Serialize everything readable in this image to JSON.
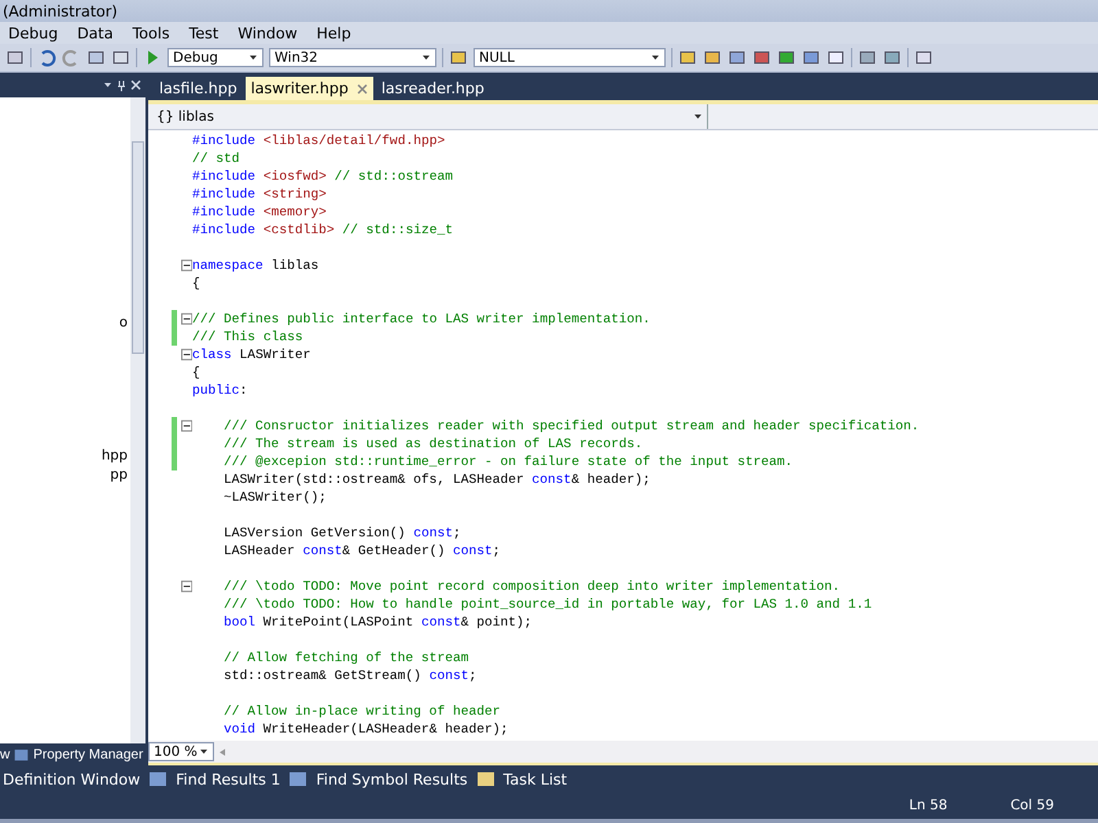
{
  "window": {
    "title": "(Administrator)"
  },
  "menu": [
    "Debug",
    "Data",
    "Tools",
    "Test",
    "Window",
    "Help"
  ],
  "toolbar": {
    "configuration": "Debug",
    "platform": "Win32",
    "target": "NULL"
  },
  "left_panel": {
    "items": [
      "o",
      "hpp",
      "pp"
    ],
    "bottom_tabs": [
      {
        "label": "w",
        "selected": false
      },
      {
        "label": "Property Manager",
        "selected": false
      }
    ]
  },
  "tabs": [
    {
      "label": "lasfile.hpp",
      "selected": false
    },
    {
      "label": "laswriter.hpp",
      "selected": true
    },
    {
      "label": "lasreader.hpp",
      "selected": false
    }
  ],
  "navigation": {
    "scope": "{} liblas"
  },
  "code": [
    {
      "kind": "code",
      "indented": false,
      "fold": false,
      "changed": false,
      "segments": [
        {
          "t": "#include",
          "kind": "keyword"
        },
        {
          "t": " <liblas/detail/fwd.hpp>",
          "kind": "string"
        }
      ]
    },
    {
      "kind": "code",
      "indented": false,
      "fold": false,
      "changed": false,
      "segments": [
        {
          "t": "// std",
          "kind": "comment"
        }
      ]
    },
    {
      "kind": "code",
      "indented": false,
      "fold": false,
      "changed": false,
      "segments": [
        {
          "t": "#include",
          "kind": "keyword"
        },
        {
          "t": " <iosfwd>",
          "kind": "string"
        },
        {
          "t": " // std::ostream",
          "kind": "comment"
        }
      ]
    },
    {
      "kind": "code",
      "indented": false,
      "fold": false,
      "changed": false,
      "segments": [
        {
          "t": "#include",
          "kind": "keyword"
        },
        {
          "t": " <string>",
          "kind": "string"
        }
      ]
    },
    {
      "kind": "code",
      "indented": false,
      "fold": false,
      "changed": false,
      "segments": [
        {
          "t": "#include",
          "kind": "keyword"
        },
        {
          "t": " <memory>",
          "kind": "string"
        }
      ]
    },
    {
      "kind": "code",
      "indented": false,
      "fold": false,
      "changed": false,
      "segments": [
        {
          "t": "#include",
          "kind": "keyword"
        },
        {
          "t": " <cstdlib>",
          "kind": "string"
        },
        {
          "t": " // std::size_t",
          "kind": "comment"
        }
      ]
    },
    {
      "kind": "blank"
    },
    {
      "kind": "code",
      "indented": false,
      "fold": true,
      "changed": false,
      "segments": [
        {
          "t": "namespace",
          "kind": "keyword"
        },
        {
          "t": " liblas"
        }
      ]
    },
    {
      "kind": "code",
      "indented": false,
      "fold": false,
      "changed": false,
      "segments": [
        {
          "t": "{"
        }
      ]
    },
    {
      "kind": "blank"
    },
    {
      "kind": "code",
      "indented": false,
      "fold": true,
      "changed": true,
      "segments": [
        {
          "t": "/// Defines public interface to LAS writer implementation.",
          "kind": "comment"
        }
      ]
    },
    {
      "kind": "code",
      "indented": false,
      "fold": false,
      "changed": true,
      "segments": [
        {
          "t": "/// This class",
          "kind": "comment"
        }
      ]
    },
    {
      "kind": "code",
      "indented": false,
      "fold": true,
      "changed": false,
      "segments": [
        {
          "t": "class",
          "kind": "keyword"
        },
        {
          "t": " LASWriter"
        }
      ]
    },
    {
      "kind": "code",
      "indented": false,
      "fold": false,
      "changed": false,
      "segments": [
        {
          "t": "{"
        }
      ]
    },
    {
      "kind": "code",
      "indented": false,
      "fold": false,
      "changed": false,
      "segments": [
        {
          "t": "public",
          "kind": "keyword"
        },
        {
          "t": ":"
        }
      ]
    },
    {
      "kind": "blank"
    },
    {
      "kind": "code",
      "indented": true,
      "fold": true,
      "changed": true,
      "segments": [
        {
          "t": "/// Consructor initializes reader with specified output stream and header specification.",
          "kind": "comment"
        }
      ]
    },
    {
      "kind": "code",
      "indented": true,
      "fold": false,
      "changed": true,
      "segments": [
        {
          "t": "/// The stream is used as destination of LAS records.",
          "kind": "comment"
        }
      ]
    },
    {
      "kind": "code",
      "indented": true,
      "fold": false,
      "changed": true,
      "segments": [
        {
          "t": "/// @excepion std::runtime_error - on failure state of the input stream.",
          "kind": "comment"
        }
      ]
    },
    {
      "kind": "code",
      "indented": true,
      "fold": false,
      "changed": false,
      "segments": [
        {
          "t": "LASWriter(std::ostream& ofs, LASHeader "
        },
        {
          "t": "const",
          "kind": "keyword"
        },
        {
          "t": "& header);"
        }
      ]
    },
    {
      "kind": "code",
      "indented": true,
      "fold": false,
      "changed": false,
      "segments": [
        {
          "t": "~LASWriter();"
        }
      ]
    },
    {
      "kind": "blank"
    },
    {
      "kind": "code",
      "indented": true,
      "fold": false,
      "changed": false,
      "segments": [
        {
          "t": "LASVersion GetVersion() "
        },
        {
          "t": "const",
          "kind": "keyword"
        },
        {
          "t": ";"
        }
      ]
    },
    {
      "kind": "code",
      "indented": true,
      "fold": false,
      "changed": false,
      "segments": [
        {
          "t": "LASHeader "
        },
        {
          "t": "const",
          "kind": "keyword"
        },
        {
          "t": "& GetHeader() "
        },
        {
          "t": "const",
          "kind": "keyword"
        },
        {
          "t": ";"
        }
      ]
    },
    {
      "kind": "blank"
    },
    {
      "kind": "code",
      "indented": true,
      "fold": true,
      "changed": false,
      "segments": [
        {
          "t": "/// \\todo TODO: Move point record composition deep into writer implementation.",
          "kind": "comment"
        }
      ]
    },
    {
      "kind": "code",
      "indented": true,
      "fold": false,
      "changed": false,
      "segments": [
        {
          "t": "/// \\todo TODO: How to handle point_source_id in portable way, for LAS 1.0 and 1.1",
          "kind": "comment"
        }
      ]
    },
    {
      "kind": "code",
      "indented": true,
      "fold": false,
      "changed": false,
      "segments": [
        {
          "t": "bool",
          "kind": "keyword"
        },
        {
          "t": " WritePoint(LASPoint "
        },
        {
          "t": "const",
          "kind": "keyword"
        },
        {
          "t": "& point);"
        }
      ]
    },
    {
      "kind": "blank"
    },
    {
      "kind": "code",
      "indented": true,
      "fold": false,
      "changed": false,
      "segments": [
        {
          "t": "// Allow fetching of the stream",
          "kind": "comment"
        }
      ]
    },
    {
      "kind": "code",
      "indented": true,
      "fold": false,
      "changed": false,
      "segments": [
        {
          "t": "std::ostream& GetStream() "
        },
        {
          "t": "const",
          "kind": "keyword"
        },
        {
          "t": ";"
        }
      ]
    },
    {
      "kind": "blank"
    },
    {
      "kind": "code",
      "indented": true,
      "fold": false,
      "changed": false,
      "segments": [
        {
          "t": "// Allow in-place writing of header",
          "kind": "comment"
        }
      ]
    },
    {
      "kind": "code",
      "indented": true,
      "fold": false,
      "changed": false,
      "segments": [
        {
          "t": "void",
          "kind": "keyword"
        },
        {
          "t": " WriteHeader(LASHeader& header);"
        }
      ]
    }
  ],
  "zoom": "100 %",
  "output_tabs": [
    "Definition Window",
    "Find Results 1",
    "Find Symbol Results",
    "Task List"
  ],
  "status_bar": {
    "line": "Ln 58",
    "column": "Col 59"
  }
}
